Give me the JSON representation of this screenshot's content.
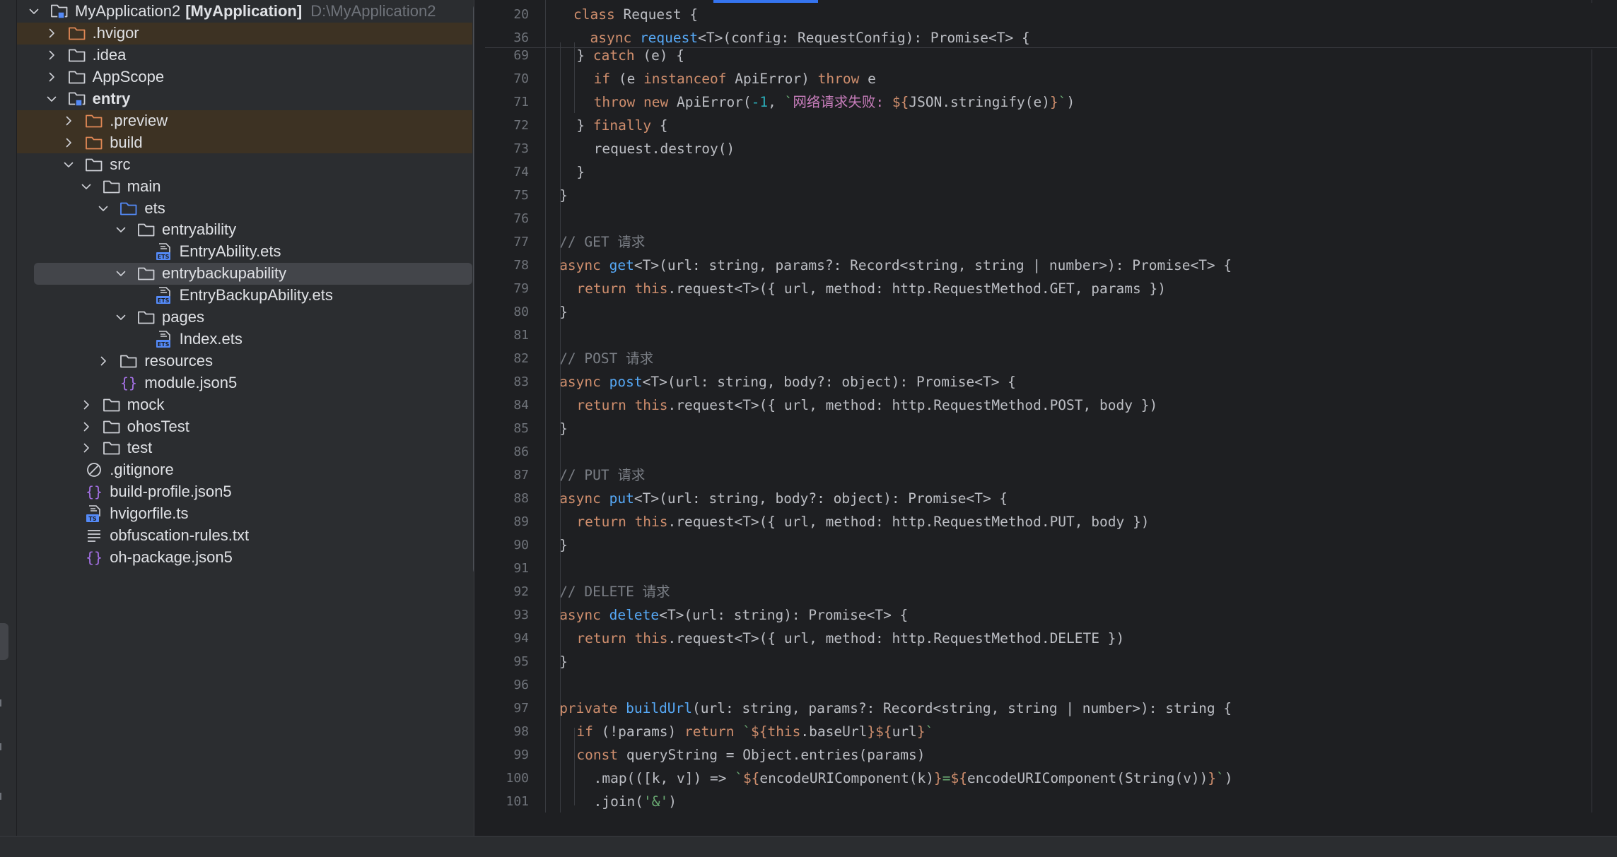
{
  "project_tree": [
    {
      "depth": 0,
      "expanded": true,
      "icon": "module-folder-icon",
      "label": "MyApplication2",
      "bold_suffix": "[MyApplication]",
      "path": "D:\\MyApplication2"
    },
    {
      "depth": 1,
      "expanded": false,
      "icon": "excluded-folder-icon",
      "label": ".hvigor",
      "excluded": true
    },
    {
      "depth": 1,
      "expanded": false,
      "icon": "folder-icon",
      "label": ".idea"
    },
    {
      "depth": 1,
      "expanded": false,
      "icon": "folder-icon",
      "label": "AppScope"
    },
    {
      "depth": 1,
      "expanded": true,
      "icon": "module-folder-icon",
      "label": "entry",
      "bold": true
    },
    {
      "depth": 2,
      "expanded": false,
      "icon": "excluded-folder-icon",
      "label": ".preview",
      "excluded": true
    },
    {
      "depth": 2,
      "expanded": false,
      "icon": "excluded-folder-icon",
      "label": "build",
      "excluded": true
    },
    {
      "depth": 2,
      "expanded": true,
      "icon": "folder-icon",
      "label": "src"
    },
    {
      "depth": 3,
      "expanded": true,
      "icon": "folder-icon",
      "label": "main"
    },
    {
      "depth": 4,
      "expanded": true,
      "icon": "source-folder-icon",
      "label": "ets"
    },
    {
      "depth": 5,
      "expanded": true,
      "icon": "folder-icon",
      "label": "entryability"
    },
    {
      "depth": 6,
      "leaf": true,
      "icon": "ets-file-icon",
      "label": "EntryAbility.ets"
    },
    {
      "depth": 5,
      "expanded": true,
      "icon": "folder-icon",
      "label": "entrybackupability",
      "selected": true
    },
    {
      "depth": 6,
      "leaf": true,
      "icon": "ets-file-icon",
      "label": "EntryBackupAbility.ets"
    },
    {
      "depth": 5,
      "expanded": true,
      "icon": "folder-icon",
      "label": "pages"
    },
    {
      "depth": 6,
      "leaf": true,
      "icon": "ets-file-icon",
      "label": "Index.ets"
    },
    {
      "depth": 4,
      "expanded": false,
      "icon": "folder-icon",
      "label": "resources"
    },
    {
      "depth": 4,
      "leaf": true,
      "icon": "json-file-icon",
      "label": "module.json5"
    },
    {
      "depth": 3,
      "expanded": false,
      "icon": "folder-icon",
      "label": "mock"
    },
    {
      "depth": 3,
      "expanded": false,
      "icon": "folder-icon",
      "label": "ohosTest"
    },
    {
      "depth": 3,
      "expanded": false,
      "icon": "folder-icon",
      "label": "test"
    },
    {
      "depth": 2,
      "leaf": true,
      "icon": "gitignore-file-icon",
      "label": ".gitignore"
    },
    {
      "depth": 2,
      "leaf": true,
      "icon": "json-file-icon",
      "label": "build-profile.json5"
    },
    {
      "depth": 2,
      "leaf": true,
      "icon": "ts-file-icon",
      "label": "hvigorfile.ts"
    },
    {
      "depth": 2,
      "leaf": true,
      "icon": "text-file-icon",
      "label": "obfuscation-rules.txt"
    },
    {
      "depth": 2,
      "leaf": true,
      "icon": "json-file-icon",
      "label": "oh-package.json5"
    }
  ],
  "sticky_lines": [
    {
      "num": "20",
      "tokens": [
        [
          "kw",
          "class "
        ],
        [
          "",
          "Request "
        ],
        [
          "",
          "{"
        ]
      ]
    },
    {
      "num": "36",
      "tokens": [
        [
          "",
          "  "
        ],
        [
          "kw",
          "async "
        ],
        [
          "fn",
          "request"
        ],
        [
          "",
          "<T>(config: RequestConfig): Promise<T> {"
        ]
      ]
    }
  ],
  "code_lines": [
    {
      "num": "69",
      "indent": 2,
      "tokens": [
        [
          "",
          "} "
        ],
        [
          "kw",
          "catch "
        ],
        [
          "",
          "(e) {"
        ]
      ]
    },
    {
      "num": "70",
      "indent": 3,
      "tokens": [
        [
          "kw",
          "if "
        ],
        [
          "",
          "(e "
        ],
        [
          "kw",
          "instanceof "
        ],
        [
          "",
          "ApiError) "
        ],
        [
          "kw",
          "throw "
        ],
        [
          "",
          "e"
        ]
      ]
    },
    {
      "num": "71",
      "indent": 3,
      "tokens": [
        [
          "kw",
          "throw new "
        ],
        [
          "",
          "ApiError("
        ],
        [
          "num",
          "-1"
        ],
        [
          "",
          ", "
        ],
        [
          "str",
          "`"
        ],
        [
          "cn-str",
          "网络请求失败: "
        ],
        [
          "interp",
          "${"
        ],
        [
          "",
          "JSON.stringify(e)"
        ],
        [
          "interp",
          "}"
        ],
        [
          "str",
          "`"
        ],
        [
          "",
          ")"
        ]
      ]
    },
    {
      "num": "72",
      "indent": 2,
      "tokens": [
        [
          "",
          "} "
        ],
        [
          "kw",
          "finally "
        ],
        [
          "",
          "{"
        ]
      ]
    },
    {
      "num": "73",
      "indent": 3,
      "tokens": [
        [
          "",
          "request.destroy()"
        ]
      ]
    },
    {
      "num": "74",
      "indent": 2,
      "tokens": [
        [
          "",
          "}"
        ]
      ]
    },
    {
      "num": "75",
      "indent": 1,
      "tokens": [
        [
          "",
          "}"
        ]
      ]
    },
    {
      "num": "76",
      "indent": 0,
      "tokens": []
    },
    {
      "num": "77",
      "indent": 1,
      "tokens": [
        [
          "cm",
          "// GET "
        ],
        [
          "cm-cn",
          "请求"
        ]
      ]
    },
    {
      "num": "78",
      "indent": 1,
      "tokens": [
        [
          "kw",
          "async "
        ],
        [
          "fn",
          "get"
        ],
        [
          "",
          "<T>(url: string, params?: Record<string, string | number>): Promise<T> {"
        ]
      ]
    },
    {
      "num": "79",
      "indent": 2,
      "tokens": [
        [
          "kw",
          "return this"
        ],
        [
          "",
          ".request<T>({ url, method: http.RequestMethod.GET, params })"
        ]
      ]
    },
    {
      "num": "80",
      "indent": 1,
      "tokens": [
        [
          "",
          "}"
        ]
      ]
    },
    {
      "num": "81",
      "indent": 0,
      "tokens": []
    },
    {
      "num": "82",
      "indent": 1,
      "tokens": [
        [
          "cm",
          "// POST "
        ],
        [
          "cm-cn",
          "请求"
        ]
      ]
    },
    {
      "num": "83",
      "indent": 1,
      "tokens": [
        [
          "kw",
          "async "
        ],
        [
          "fn",
          "post"
        ],
        [
          "",
          "<T>(url: string, body?: object): Promise<T> {"
        ]
      ]
    },
    {
      "num": "84",
      "indent": 2,
      "tokens": [
        [
          "kw",
          "return this"
        ],
        [
          "",
          ".request<T>({ url, method: http.RequestMethod.POST, body })"
        ]
      ]
    },
    {
      "num": "85",
      "indent": 1,
      "tokens": [
        [
          "",
          "}"
        ]
      ]
    },
    {
      "num": "86",
      "indent": 0,
      "tokens": []
    },
    {
      "num": "87",
      "indent": 1,
      "tokens": [
        [
          "cm",
          "// PUT "
        ],
        [
          "cm-cn",
          "请求"
        ]
      ]
    },
    {
      "num": "88",
      "indent": 1,
      "tokens": [
        [
          "kw",
          "async "
        ],
        [
          "fn",
          "put"
        ],
        [
          "",
          "<T>(url: string, body?: object): Promise<T> {"
        ]
      ]
    },
    {
      "num": "89",
      "indent": 2,
      "tokens": [
        [
          "kw",
          "return this"
        ],
        [
          "",
          ".request<T>({ url, method: http.RequestMethod.PUT, body })"
        ]
      ]
    },
    {
      "num": "90",
      "indent": 1,
      "tokens": [
        [
          "",
          "}"
        ]
      ]
    },
    {
      "num": "91",
      "indent": 0,
      "tokens": []
    },
    {
      "num": "92",
      "indent": 1,
      "tokens": [
        [
          "cm",
          "// DELETE "
        ],
        [
          "cm-cn",
          "请求"
        ]
      ]
    },
    {
      "num": "93",
      "indent": 1,
      "tokens": [
        [
          "kw",
          "async "
        ],
        [
          "fn",
          "delete"
        ],
        [
          "",
          "<T>(url: string): Promise<T> {"
        ]
      ]
    },
    {
      "num": "94",
      "indent": 2,
      "tokens": [
        [
          "kw",
          "return this"
        ],
        [
          "",
          ".request<T>({ url, method: http.RequestMethod.DELETE })"
        ]
      ]
    },
    {
      "num": "95",
      "indent": 1,
      "tokens": [
        [
          "",
          "}"
        ]
      ]
    },
    {
      "num": "96",
      "indent": 0,
      "tokens": []
    },
    {
      "num": "97",
      "indent": 1,
      "tokens": [
        [
          "kw",
          "private "
        ],
        [
          "fn",
          "buildUrl"
        ],
        [
          "",
          "(url: string, params?: Record<string, string | number>): string {"
        ]
      ]
    },
    {
      "num": "98",
      "indent": 2,
      "tokens": [
        [
          "kw",
          "if "
        ],
        [
          "",
          "(!params) "
        ],
        [
          "kw",
          "return "
        ],
        [
          "str",
          "`"
        ],
        [
          "interp",
          "${"
        ],
        [
          "kw",
          "this"
        ],
        [
          "",
          ".baseUrl"
        ],
        [
          "interp",
          "}${"
        ],
        [
          "",
          "url"
        ],
        [
          "interp",
          "}"
        ],
        [
          "str",
          "`"
        ]
      ]
    },
    {
      "num": "99",
      "indent": 2,
      "tokens": [
        [
          "kw",
          "const "
        ],
        [
          "",
          "queryString = Object.entries(params)"
        ]
      ]
    },
    {
      "num": "100",
      "indent": 3,
      "tokens": [
        [
          "",
          ".map(([k, v]) => "
        ],
        [
          "str",
          "`"
        ],
        [
          "interp",
          "${"
        ],
        [
          "",
          "encodeURIComponent(k)"
        ],
        [
          "interp",
          "}"
        ],
        [
          "str",
          "="
        ],
        [
          "interp",
          "${"
        ],
        [
          "",
          "encodeURIComponent(String(v))"
        ],
        [
          "interp",
          "}"
        ],
        [
          "str",
          "`"
        ],
        [
          "",
          ")"
        ]
      ]
    },
    {
      "num": "101",
      "indent": 3,
      "tokens": [
        [
          "",
          ".join("
        ],
        [
          "str",
          "'&'"
        ],
        [
          "",
          ")"
        ]
      ]
    }
  ],
  "colors": {
    "accent": "#3574f0",
    "excluded_row": "#3d3223",
    "selected_row": "#43454a",
    "keyword": "#cf8e6d",
    "function": "#56a8f5",
    "string": "#6aab73",
    "comment": "#7a7e85",
    "number": "#2aacb8"
  }
}
